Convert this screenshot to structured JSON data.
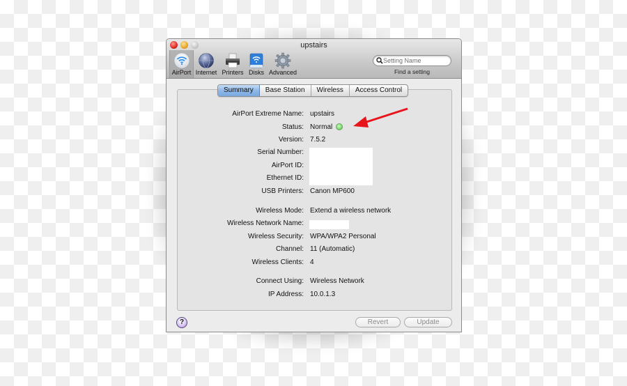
{
  "window": {
    "title": "upstairs"
  },
  "toolbar": {
    "items": [
      {
        "label": "AirPort",
        "icon": "airport-wifi-icon",
        "selected": true
      },
      {
        "label": "Internet",
        "icon": "globe-icon",
        "selected": false
      },
      {
        "label": "Printers",
        "icon": "printer-icon",
        "selected": false
      },
      {
        "label": "Disks",
        "icon": "disk-icon",
        "selected": false
      },
      {
        "label": "Advanced",
        "icon": "gear-icon",
        "selected": false
      }
    ],
    "search": {
      "placeholder": "Setting Name",
      "value": "",
      "caption": "Find a setting"
    }
  },
  "tabs": [
    {
      "label": "Summary",
      "active": true
    },
    {
      "label": "Base Station",
      "active": false
    },
    {
      "label": "Wireless",
      "active": false
    },
    {
      "label": "Access Control",
      "active": false
    }
  ],
  "summary": {
    "fields": [
      {
        "label": "AirPort Extreme Name:",
        "value": "upstairs"
      },
      {
        "label": "Status:",
        "value": "Normal",
        "status_color": "#7fdc73"
      },
      {
        "label": "Version:",
        "value": "7.5.2"
      },
      {
        "label": "Serial Number:",
        "value": ""
      },
      {
        "label": "AirPort ID:",
        "value": ""
      },
      {
        "label": "Ethernet ID:",
        "value": ""
      },
      {
        "label": "USB Printers:",
        "value": "Canon MP600"
      },
      {
        "label": "Wireless Mode:",
        "value": "Extend a wireless network"
      },
      {
        "label": "Wireless Network Name:",
        "value": ""
      },
      {
        "label": "Wireless Security:",
        "value": "WPA/WPA2 Personal"
      },
      {
        "label": "Channel:",
        "value": "11 (Automatic)"
      },
      {
        "label": "Wireless Clients:",
        "value": "4"
      },
      {
        "label": "Connect Using:",
        "value": "Wireless Network"
      },
      {
        "label": "IP Address:",
        "value": "10.0.1.3"
      }
    ]
  },
  "footer": {
    "help_label": "?",
    "revert_label": "Revert",
    "update_label": "Update"
  },
  "annotation": {
    "arrow_color": "#e8141c"
  }
}
